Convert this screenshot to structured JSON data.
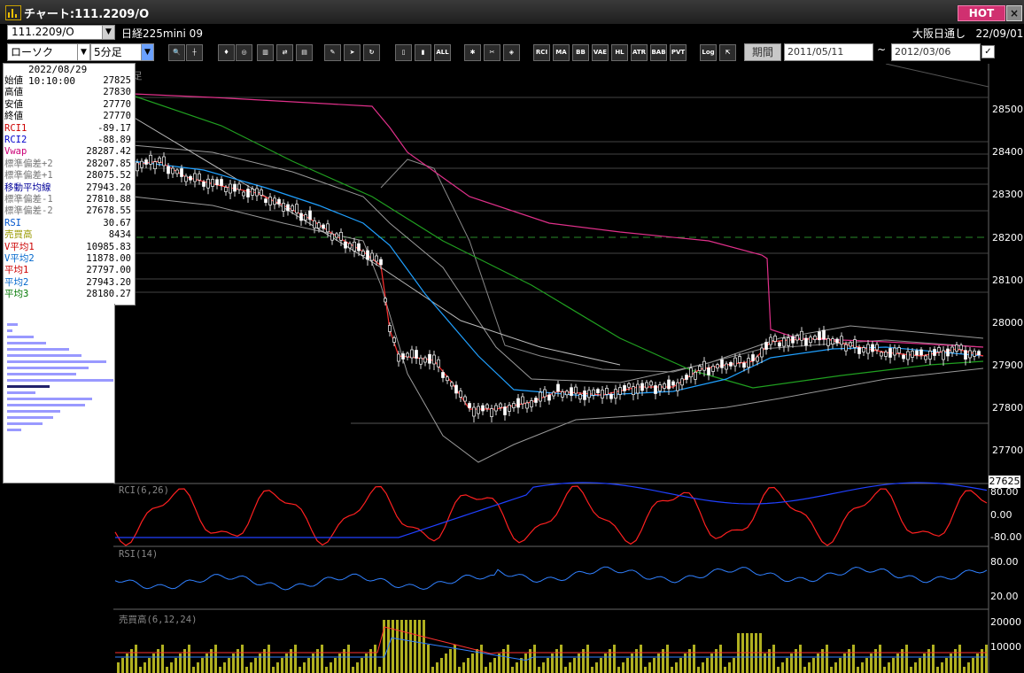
{
  "window": {
    "title": "チャート:111.2209/O",
    "hot_label": "HOT",
    "close_label": "×"
  },
  "header": {
    "code": "111.2209/O",
    "instrument": "日経225mini 09",
    "market": "大阪日通し",
    "date": "22/09/01"
  },
  "toolbar": {
    "chart_type": "ローソク",
    "interval": "5分足",
    "buttons": [
      "zoom",
      "cursor",
      "bull",
      "magnify",
      "chart-a",
      "chart-b",
      "note",
      "pen",
      "arrow",
      "rotate",
      "bar-a",
      "bar-b",
      "ALL",
      "gear",
      "wrench",
      "palette",
      "RCI",
      "MA",
      "BB",
      "VAE",
      "HL",
      "ATR",
      "BAB",
      "PVT",
      "Log",
      "export"
    ],
    "period_label": "期間",
    "date_from": "2011/05/11",
    "tilde": "~",
    "date_to": "2012/03/06",
    "check": "✓"
  },
  "info": {
    "datetime": "2022/08/29 10:10:00",
    "rows": [
      {
        "label": "始値",
        "value": "27825",
        "color": "#000000"
      },
      {
        "label": "高値",
        "value": "27830",
        "color": "#000000"
      },
      {
        "label": "安値",
        "value": "27770",
        "color": "#000000"
      },
      {
        "label": "終値",
        "value": "27770",
        "color": "#000000"
      },
      {
        "label": "RCI1",
        "value": "-89.17",
        "color": "#cc0000"
      },
      {
        "label": "RCI2",
        "value": "-88.89",
        "color": "#0000cc"
      },
      {
        "label": "Vwap",
        "value": "28287.42",
        "color": "#cc0077"
      },
      {
        "label": "標準偏差+2",
        "value": "28207.85",
        "color": "#777777"
      },
      {
        "label": "標準偏差+1",
        "value": "28075.52",
        "color": "#777777"
      },
      {
        "label": "移動平均線",
        "value": "27943.20",
        "color": "#000099"
      },
      {
        "label": "標準偏差-1",
        "value": "27810.88",
        "color": "#777777"
      },
      {
        "label": "標準偏差-2",
        "value": "27678.55",
        "color": "#777777"
      },
      {
        "label": "RSI",
        "value": "30.67",
        "color": "#0055cc"
      },
      {
        "label": "売買高",
        "value": "8434",
        "color": "#999900"
      },
      {
        "label": "V平均1",
        "value": "10985.83",
        "color": "#cc0000"
      },
      {
        "label": "V平均2",
        "value": "11878.00",
        "color": "#0066cc"
      },
      {
        "label": "平均1",
        "value": "27797.00",
        "color": "#cc0000"
      },
      {
        "label": "平均2",
        "value": "27943.20",
        "color": "#0066cc"
      },
      {
        "label": "平均3",
        "value": "28180.27",
        "color": "#007700"
      }
    ]
  },
  "panes": {
    "main_label": "足",
    "rci_label": "RCI(6,26)",
    "rsi_label": "RSI(14)",
    "vol_label": "売買高(6,12,24)"
  },
  "axis": {
    "price_ticks": [
      "28500",
      "28400",
      "28300",
      "28200",
      "28100",
      "28000",
      "27900",
      "27800",
      "27700"
    ],
    "current_price": "27625",
    "rci_ticks": [
      "80.00",
      "0.00",
      "-80.00"
    ],
    "rsi_ticks": [
      "80.00",
      "20.00"
    ],
    "vol_ticks": [
      "20000",
      "10000"
    ]
  },
  "colors": {
    "rci_short": "#ff2020",
    "rci_long": "#2040ff",
    "rsi": "#3080ff",
    "ma_short": "#ff3030",
    "ma_mid": "#20a0ff",
    "ma_long": "#20a020",
    "vwap": "#e0308a",
    "volume": "#b0b020"
  }
}
